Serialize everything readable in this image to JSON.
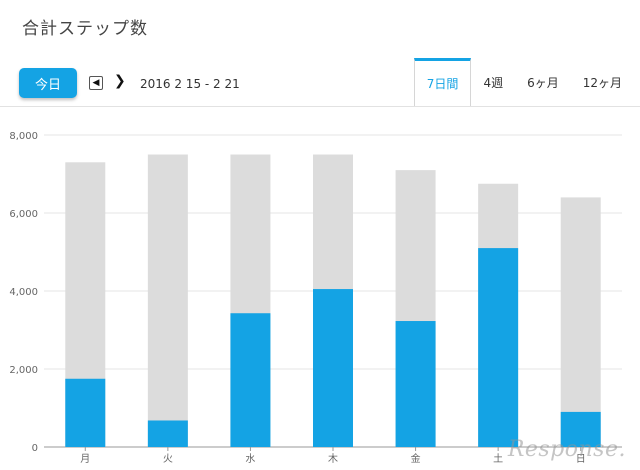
{
  "page": {
    "title": "合計ステップ数"
  },
  "toolbar": {
    "today_label": "今日",
    "date_range": "2016 2 15 - 2 21",
    "tabs": [
      {
        "label": "7日間",
        "active": true
      },
      {
        "label": "4週",
        "active": false
      },
      {
        "label": "6ヶ月",
        "active": false
      },
      {
        "label": "12ヶ月",
        "active": false
      }
    ]
  },
  "colors": {
    "accent": "#14a3e4",
    "goal": "#dcdcdc"
  },
  "watermark": "Response.",
  "chart_data": {
    "type": "bar",
    "categories": [
      "月",
      "火",
      "水",
      "木",
      "金",
      "土",
      "日"
    ],
    "series": [
      {
        "values": [
          7300,
          7500,
          7500,
          7500,
          7100,
          6750,
          6400
        ]
      },
      {
        "values": [
          1750,
          680,
          3430,
          4050,
          3230,
          5100,
          900
        ]
      }
    ],
    "yticks": [
      "0",
      "2,000",
      "4,000",
      "6,000",
      "8,000"
    ],
    "ylim": [
      0,
      8000
    ],
    "grid": true
  }
}
